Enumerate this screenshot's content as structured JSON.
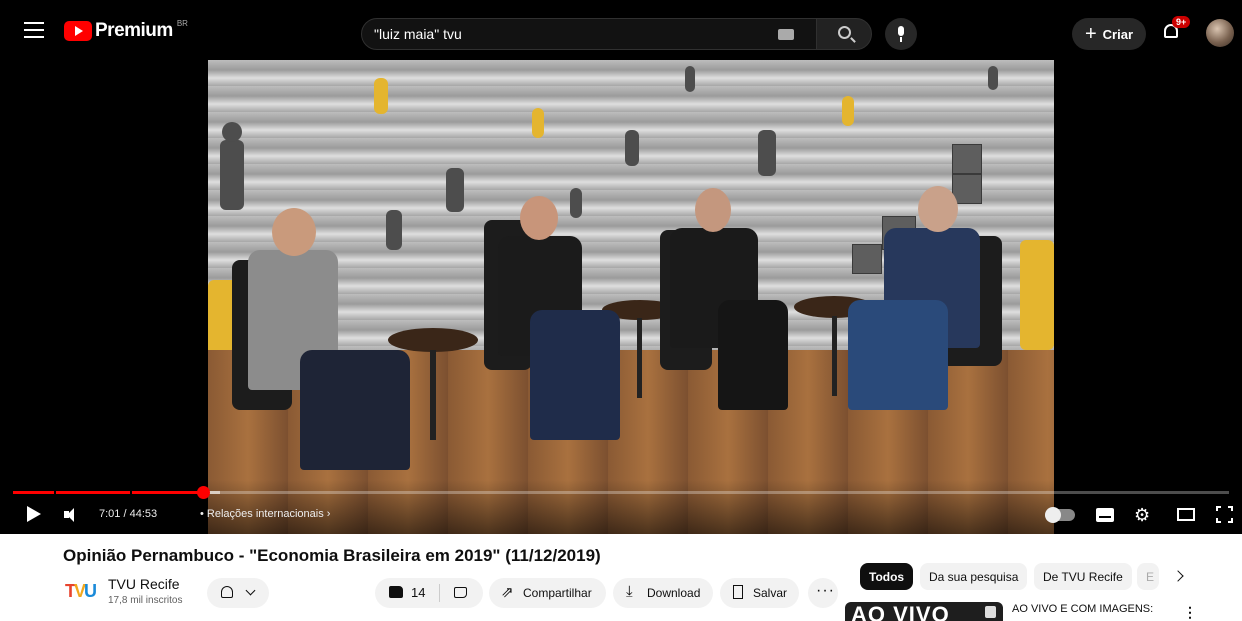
{
  "header": {
    "logo_text": "Premium",
    "country_code": "BR",
    "search_query": "\"luiz maia\" tvu",
    "create_label": "Criar",
    "notification_badge": "9+"
  },
  "player": {
    "current_time": "7:01",
    "duration": "44:53",
    "time_display": "7:01 / 44:53",
    "separator": "•",
    "chapter": "Relações internacionais",
    "chapter_arrow": "›",
    "progress_fraction": 0.156,
    "buffer_fraction": 0.17,
    "chapter_markers_fraction": [
      0.034,
      0.096
    ],
    "icons": [
      "play-icon",
      "volume-icon",
      "autoplay-toggle",
      "subtitles-icon",
      "gear-icon",
      "theater-icon",
      "fullscreen-icon"
    ]
  },
  "video": {
    "title": "Opinião Pernambuco - \"Economia Brasileira em 2019\" (11/12/2019)",
    "channel": {
      "name": "TVU Recife",
      "subscribers": "17,8 mil inscritos",
      "logo_text": {
        "t": "T",
        "v": "V",
        "u": "U"
      }
    },
    "likes": "14",
    "actions": {
      "share": "Compartilhar",
      "download": "Download",
      "save": "Salvar",
      "more": "···"
    }
  },
  "sidebar": {
    "chips": [
      {
        "label": "Todos",
        "active": true
      },
      {
        "label": "Da sua pesquisa",
        "active": false
      },
      {
        "label": "De TVU Recife",
        "active": false
      },
      {
        "label": "E",
        "active": false
      }
    ],
    "recommendation": {
      "thumbnail_text": "AO VIVO",
      "title": "AO VIVO E COM IMAGENS:",
      "menu": "⋮"
    }
  },
  "colors": {
    "brand_red": "#ff0000",
    "topbar_bg": "#000000",
    "chip_active_bg": "#0f0f0f",
    "chip_inactive_bg": "#f2f2f2",
    "channel_logo": [
      "#e8442e",
      "#f2a81d",
      "#1a8ad9"
    ]
  }
}
